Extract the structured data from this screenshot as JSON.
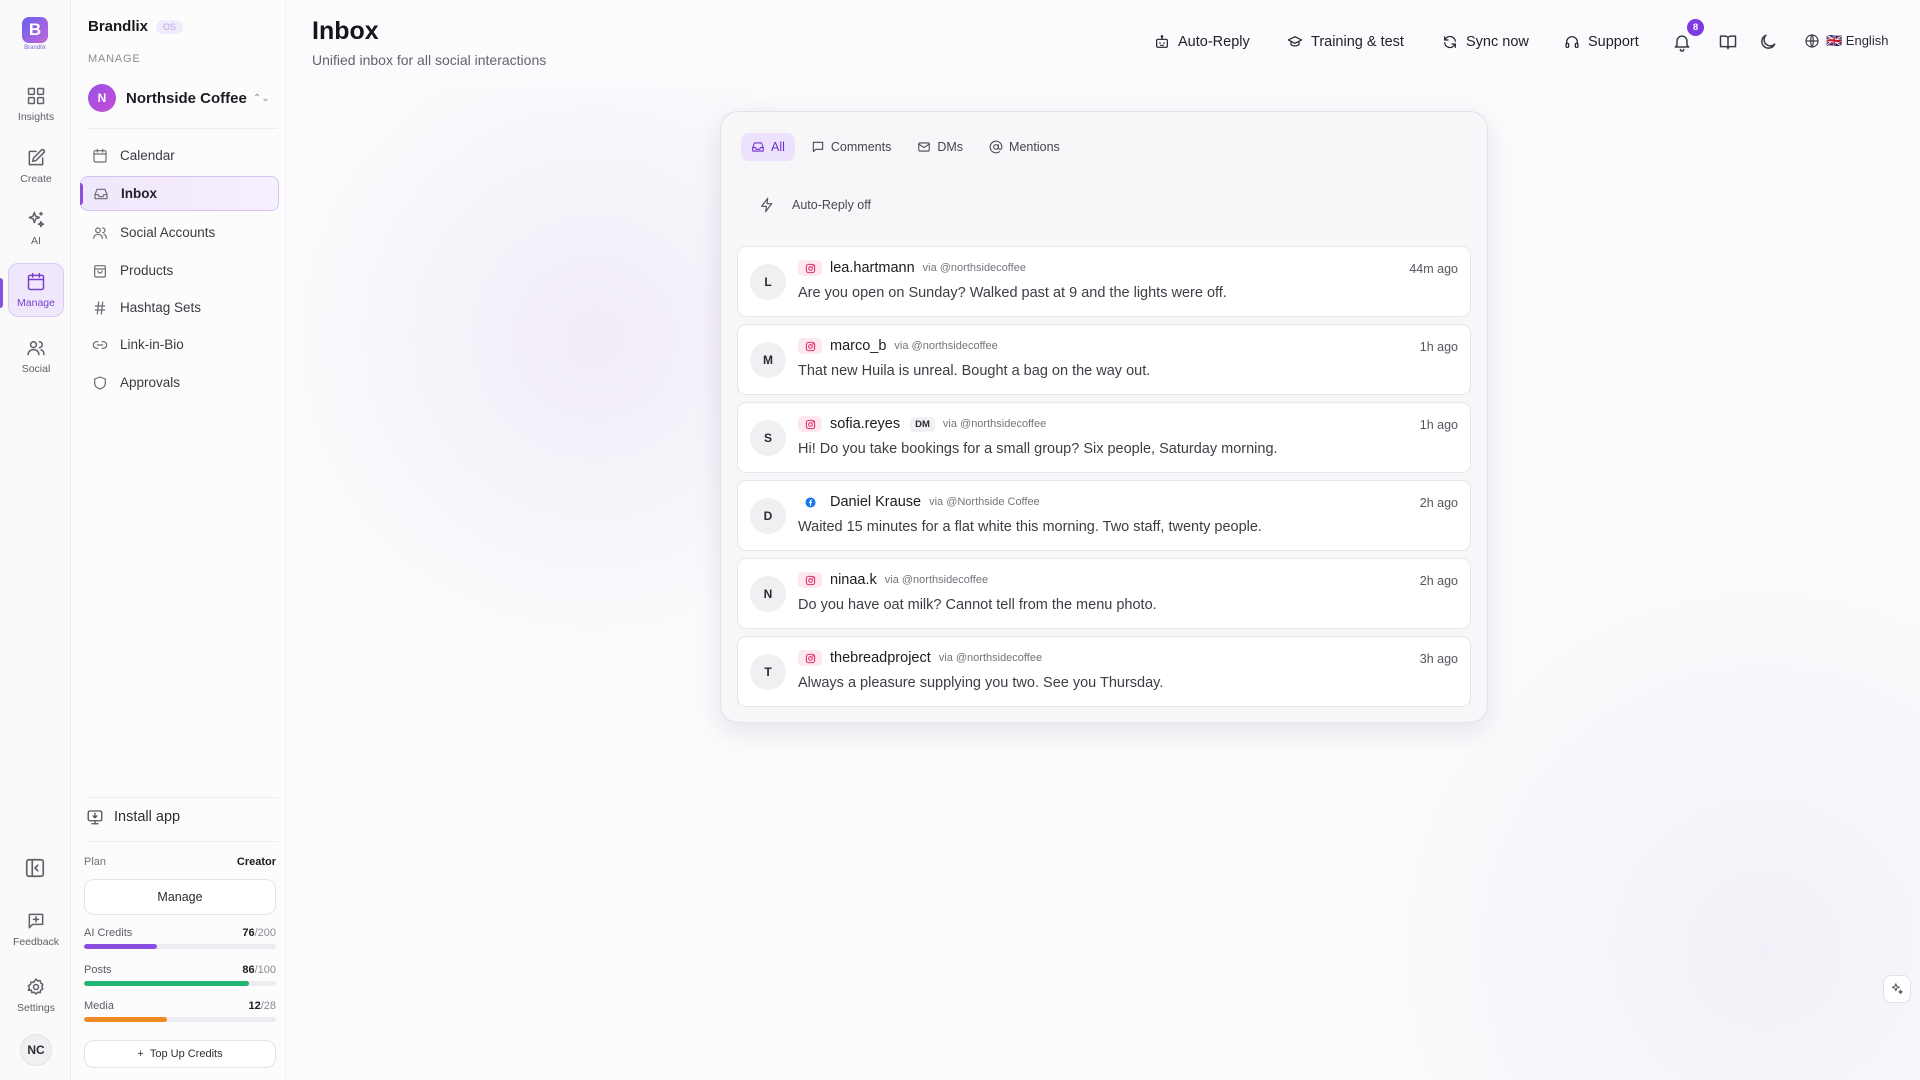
{
  "brand": {
    "logo_letter": "B",
    "logo_text": "Brandlix",
    "name": "Brandlix",
    "badge": "OS"
  },
  "rail": {
    "items": [
      {
        "label": "Insights",
        "icon": "grid-icon"
      },
      {
        "label": "Create",
        "icon": "edit-icon"
      },
      {
        "label": "AI",
        "icon": "sparkles-icon"
      },
      {
        "label": "Manage",
        "icon": "calendar-icon",
        "active": true
      },
      {
        "label": "Social",
        "icon": "users-icon"
      }
    ],
    "feedback_label": "Feedback",
    "settings_label": "Settings",
    "avatar_initials": "NC"
  },
  "sidebar": {
    "section_label": "MANAGE",
    "workspace": {
      "initial": "N",
      "name": "Northside Coffee"
    },
    "nav": [
      {
        "label": "Calendar",
        "icon": "calendar-icon"
      },
      {
        "label": "Inbox",
        "icon": "inbox-icon",
        "active": true
      },
      {
        "label": "Social Accounts",
        "icon": "users-icon"
      },
      {
        "label": "Products",
        "icon": "bag-icon"
      },
      {
        "label": "Hashtag Sets",
        "icon": "hash-icon"
      },
      {
        "label": "Link-in-Bio",
        "icon": "link-icon"
      },
      {
        "label": "Approvals",
        "icon": "shield-icon"
      }
    ],
    "install_label": "Install app",
    "plan": {
      "label": "Plan",
      "value": "Creator"
    },
    "manage_label": "Manage",
    "usage": [
      {
        "label": "AI Credits",
        "used": "76",
        "total": "/200",
        "fraction": 0.38,
        "color": "#8b4fe0"
      },
      {
        "label": "Posts",
        "used": "86",
        "total": "/100",
        "fraction": 0.86,
        "color": "#22b573"
      },
      {
        "label": "Media",
        "used": "12",
        "total": "/28",
        "fraction": 0.43,
        "color": "#f08a24"
      }
    ],
    "topup_label": "Top Up Credits"
  },
  "header": {
    "title": "Inbox",
    "subtitle": "Unified inbox for all social interactions",
    "buttons": [
      {
        "label": "Auto-Reply",
        "icon": "robot-icon"
      },
      {
        "label": "Training & test",
        "icon": "graduation-cap-icon"
      },
      {
        "label": "Sync now",
        "icon": "refresh-icon"
      },
      {
        "label": "Support",
        "icon": "headphones-icon"
      }
    ],
    "notification_count": "8",
    "language": "🇬🇧 English"
  },
  "inbox": {
    "tabs": [
      {
        "label": "All",
        "icon": "inbox-icon",
        "active": true
      },
      {
        "label": "Comments",
        "icon": "comment-icon"
      },
      {
        "label": "DMs",
        "icon": "mail-icon"
      },
      {
        "label": "Mentions",
        "icon": "at-icon"
      }
    ],
    "auto_reply_status": "Auto-Reply off",
    "messages": [
      {
        "initial": "L",
        "platform": "instagram",
        "author": "lea.hartmann",
        "dm": "",
        "via": "via @northsidecoffee",
        "time": "44m ago",
        "text": "Are you open on Sunday? Walked past at 9 and the lights were off."
      },
      {
        "initial": "M",
        "platform": "instagram",
        "author": "marco_b",
        "dm": "",
        "via": "via @northsidecoffee",
        "time": "1h ago",
        "text": "That new Huila is unreal. Bought a bag on the way out."
      },
      {
        "initial": "S",
        "platform": "instagram",
        "author": "sofia.reyes",
        "dm": "DM",
        "via": "via @northsidecoffee",
        "time": "1h ago",
        "text": "Hi! Do you take bookings for a small group? Six people, Saturday morning."
      },
      {
        "initial": "D",
        "platform": "facebook",
        "author": "Daniel Krause",
        "dm": "",
        "via": "via @Northside Coffee",
        "time": "2h ago",
        "text": "Waited 15 minutes for a flat white this morning. Two staff, twenty people."
      },
      {
        "initial": "N",
        "platform": "instagram",
        "author": "ninaa.k",
        "dm": "",
        "via": "via @northsidecoffee",
        "time": "2h ago",
        "text": "Do you have oat milk? Cannot tell from the menu photo."
      },
      {
        "initial": "T",
        "platform": "instagram",
        "author": "thebreadproject",
        "dm": "",
        "via": "via @northsidecoffee",
        "time": "3h ago",
        "text": "Always a pleasure supplying you two. See you Thursday."
      }
    ]
  }
}
